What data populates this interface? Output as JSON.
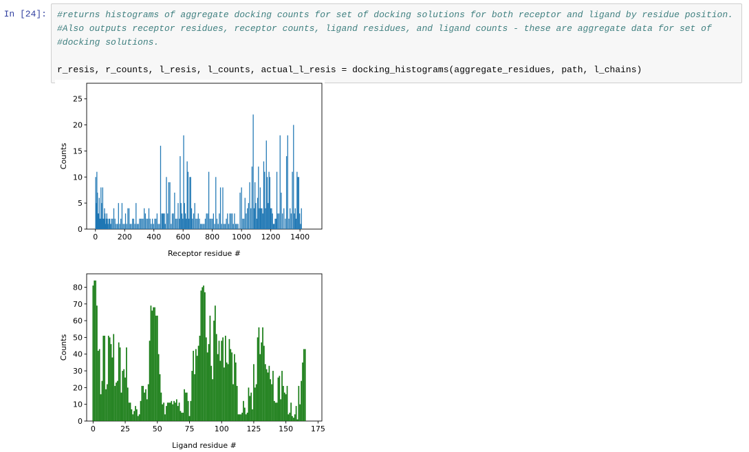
{
  "notebook": {
    "prompt_label": "In [24]:",
    "code_lines": [
      "#returns histograms of aggregate docking counts for set of docking solutions for both receptor and ligand by residue position.",
      "#Also outputs receptor residues, receptor counts, ligand residues, and ligand counts - these are aggregate data for set of",
      "#docking solutions.",
      "",
      "r_resis, r_counts, l_resis, l_counts, actual_l_resis = docking_histograms(aggregate_residues, path, l_chains)"
    ],
    "code_line_1": "#returns histograms of aggregate docking counts for set of docking solutions for both receptor and ligand by residue position.",
    "code_line_2": "#Also outputs receptor residues, receptor counts, ligand residues, and ligand counts - these are aggregate data for set of",
    "code_line_3": "#docking solutions.",
    "code_line_4": "r_resis, r_counts, l_resis, l_counts, actual_l_resis = docking_histograms(aggregate_residues, path, l_chains)",
    "colors": {
      "prompt": "#303F9F",
      "comment": "#408080",
      "cell_background": "#f7f7f7",
      "cell_border": "#cfcfcf"
    }
  },
  "chart_data": [
    {
      "id": "receptor-histogram",
      "type": "bar",
      "title": "",
      "xlabel": "Receptor residue #",
      "ylabel": "Counts",
      "color": "#1f77b4",
      "xlim": [
        -60,
        1550
      ],
      "ylim": [
        0,
        28
      ],
      "xticks": [
        0,
        200,
        400,
        600,
        800,
        1000,
        1200,
        1400
      ],
      "yticks": [
        0,
        5,
        10,
        15,
        20,
        25
      ],
      "grid": false,
      "legend": "none",
      "x": [
        2,
        6,
        10,
        14,
        18,
        22,
        26,
        30,
        34,
        38,
        42,
        46,
        50,
        54,
        58,
        62,
        66,
        70,
        74,
        78,
        82,
        86,
        92,
        98,
        104,
        110,
        118,
        126,
        134,
        142,
        150,
        158,
        166,
        174,
        182,
        190,
        198,
        206,
        214,
        222,
        230,
        238,
        246,
        254,
        262,
        270,
        278,
        286,
        294,
        302,
        310,
        318,
        326,
        334,
        342,
        350,
        358,
        366,
        374,
        382,
        390,
        398,
        406,
        414,
        422,
        430,
        438,
        446,
        454,
        460,
        466,
        472,
        478,
        486,
        494,
        502,
        510,
        518,
        526,
        534,
        542,
        550,
        558,
        566,
        574,
        580,
        586,
        592,
        598,
        604,
        610,
        616,
        622,
        628,
        634,
        640,
        646,
        652,
        658,
        664,
        672,
        680,
        688,
        696,
        704,
        712,
        720,
        728,
        736,
        744,
        752,
        760,
        768,
        776,
        784,
        792,
        800,
        808,
        816,
        824,
        832,
        840,
        848,
        856,
        864,
        872,
        880,
        888,
        896,
        904,
        912,
        920,
        928,
        936,
        944,
        952,
        960,
        968,
        976,
        990,
        1000,
        1008,
        1016,
        1024,
        1032,
        1040,
        1048,
        1056,
        1064,
        1072,
        1080,
        1086,
        1092,
        1098,
        1104,
        1110,
        1116,
        1122,
        1128,
        1134,
        1140,
        1146,
        1152,
        1158,
        1164,
        1170,
        1176,
        1182,
        1188,
        1194,
        1200,
        1206,
        1212,
        1218,
        1224,
        1230,
        1236,
        1242,
        1248,
        1256,
        1264,
        1272,
        1280,
        1290,
        1300,
        1308,
        1316,
        1324,
        1332,
        1340,
        1348,
        1356,
        1362,
        1368,
        1374,
        1380,
        1386,
        1392,
        1398,
        1404,
        1410,
        1416,
        1422,
        1428,
        1436,
        1444,
        1452,
        1460,
        1470,
        1480
      ],
      "values": [
        10,
        5,
        11,
        7,
        3,
        3,
        6,
        2,
        2,
        8,
        5,
        2,
        8,
        2,
        2,
        4,
        3,
        1,
        2,
        3,
        2,
        1,
        2,
        2,
        1,
        2,
        2,
        4,
        2,
        1,
        1,
        5,
        1,
        2,
        5,
        1,
        1,
        3,
        1,
        4,
        4,
        1,
        1,
        2,
        2,
        1,
        5,
        1,
        1,
        2,
        2,
        2,
        2,
        4,
        3,
        2,
        2,
        4,
        2,
        1,
        2,
        1,
        2,
        2,
        3,
        1,
        1,
        16,
        3,
        3,
        3,
        3,
        1,
        10,
        3,
        9,
        9,
        1,
        3,
        3,
        7,
        2,
        2,
        5,
        2,
        14,
        5,
        3,
        2,
        18,
        5,
        3,
        2,
        13,
        11,
        2,
        10,
        10,
        4,
        2,
        3,
        5,
        2,
        2,
        3,
        2,
        1,
        1,
        1,
        1,
        2,
        3,
        3,
        11,
        2,
        2,
        2,
        3,
        1,
        10,
        2,
        1,
        3,
        8,
        1,
        8,
        1,
        1,
        2,
        3,
        1,
        3,
        3,
        3,
        1,
        3,
        1,
        1,
        1,
        7,
        8,
        2,
        2,
        6,
        3,
        4,
        5,
        9,
        4,
        12,
        22,
        4,
        9,
        5,
        2,
        6,
        12,
        4,
        8,
        4,
        4,
        3,
        13,
        11,
        4,
        17,
        10,
        5,
        11,
        10,
        4,
        4,
        3,
        1,
        1,
        2,
        2,
        11,
        3,
        3,
        18,
        7,
        3,
        4,
        2,
        14,
        18,
        2,
        4,
        3,
        11,
        20,
        3,
        4,
        2,
        11,
        10,
        10,
        3,
        1,
        4
      ]
    },
    {
      "id": "ligand-histogram",
      "type": "bar",
      "title": "",
      "xlabel": "Ligand residue #",
      "ylabel": "Counts",
      "color": "#12790f",
      "xlim": [
        -5,
        178
      ],
      "ylim": [
        0,
        88
      ],
      "xticks": [
        0,
        25,
        50,
        75,
        100,
        125,
        150,
        175
      ],
      "yticks": [
        0,
        10,
        20,
        30,
        40,
        50,
        60,
        70,
        80
      ],
      "grid": false,
      "legend": "none",
      "x": [
        0,
        1,
        2,
        3,
        4,
        5,
        6,
        7,
        8,
        9,
        10,
        11,
        12,
        13,
        14,
        15,
        16,
        17,
        18,
        19,
        20,
        21,
        22,
        23,
        24,
        25,
        26,
        27,
        28,
        29,
        30,
        31,
        32,
        33,
        34,
        35,
        36,
        37,
        38,
        39,
        40,
        41,
        42,
        43,
        44,
        45,
        46,
        47,
        48,
        49,
        50,
        51,
        52,
        53,
        54,
        55,
        56,
        57,
        58,
        59,
        60,
        61,
        62,
        63,
        64,
        65,
        66,
        67,
        68,
        69,
        70,
        71,
        72,
        73,
        74,
        75,
        76,
        77,
        78,
        79,
        80,
        81,
        82,
        83,
        84,
        85,
        86,
        87,
        88,
        89,
        90,
        91,
        92,
        93,
        94,
        95,
        96,
        97,
        98,
        99,
        100,
        101,
        102,
        103,
        104,
        105,
        106,
        107,
        108,
        109,
        110,
        111,
        112,
        113,
        114,
        115,
        116,
        117,
        118,
        119,
        120,
        121,
        122,
        123,
        124,
        125,
        126,
        127,
        128,
        129,
        130,
        131,
        132,
        133,
        134,
        135,
        136,
        137,
        138,
        139,
        140,
        141,
        142,
        143,
        144,
        145,
        146,
        147,
        148,
        149,
        150,
        151,
        152,
        153,
        154,
        155,
        156,
        157,
        158,
        159,
        160,
        161,
        162,
        163,
        164,
        165,
        166,
        167,
        168
      ],
      "values": [
        81,
        84,
        84,
        69,
        42,
        43,
        16,
        24,
        51,
        51,
        19,
        22,
        51,
        50,
        46,
        38,
        52,
        21,
        23,
        24,
        47,
        44,
        17,
        30,
        31,
        26,
        44,
        20,
        11,
        11,
        7,
        4,
        6,
        9,
        7,
        3,
        4,
        12,
        21,
        21,
        17,
        19,
        13,
        22,
        48,
        69,
        66,
        68,
        68,
        63,
        63,
        40,
        28,
        17,
        10,
        11,
        4,
        9,
        11,
        11,
        11,
        12,
        10,
        12,
        11,
        13,
        9,
        11,
        6,
        5,
        5,
        19,
        17,
        17,
        12,
        3,
        12,
        30,
        42,
        28,
        43,
        39,
        45,
        51,
        78,
        80,
        81,
        77,
        50,
        41,
        46,
        63,
        33,
        25,
        60,
        69,
        52,
        40,
        48,
        36,
        48,
        50,
        32,
        51,
        35,
        34,
        49,
        43,
        41,
        22,
        40,
        35,
        21,
        4,
        4,
        4,
        5,
        12,
        8,
        4,
        5,
        20,
        15,
        17,
        7,
        34,
        20,
        22,
        50,
        56,
        40,
        47,
        56,
        45,
        34,
        31,
        29,
        33,
        25,
        22,
        30,
        12,
        11,
        11,
        26,
        27,
        13,
        30,
        21,
        17,
        16,
        21,
        4,
        5,
        11,
        3,
        2,
        4,
        9,
        1,
        21,
        10,
        24,
        35,
        43,
        43
      ]
    }
  ]
}
